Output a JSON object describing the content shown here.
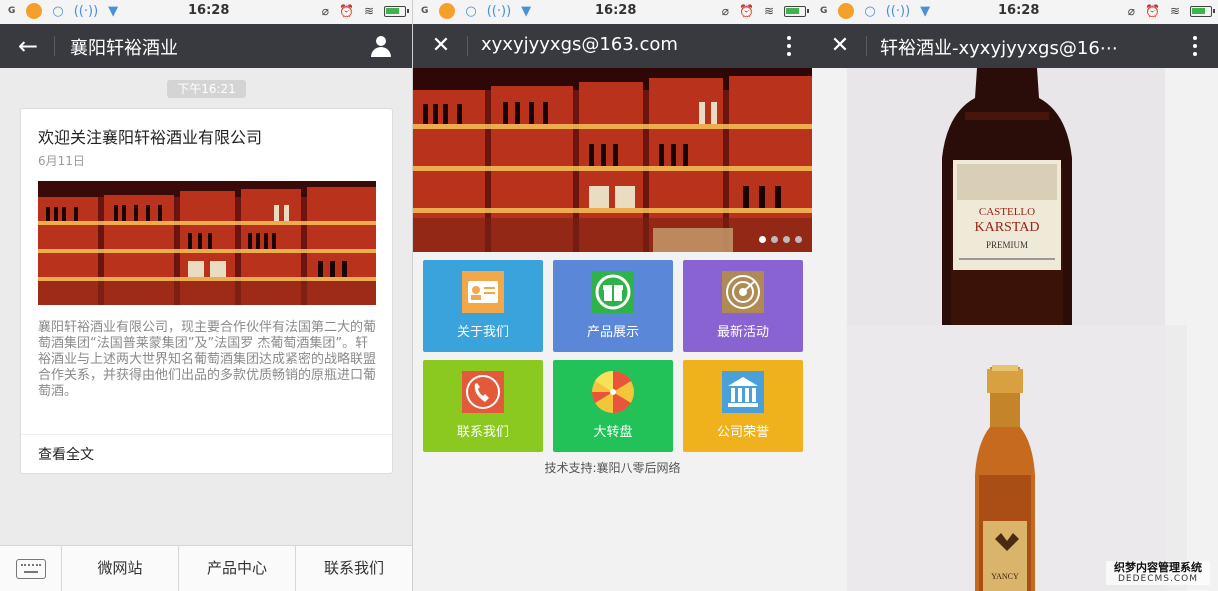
{
  "statusbar": {
    "signal": "G",
    "time": "16:28"
  },
  "chat": {
    "title": "襄阳轩裕酒业",
    "timestamp": "下午16:21",
    "card": {
      "title": "欢迎关注襄阳轩裕酒业有限公司",
      "date": "6月11日",
      "summary": "襄阳轩裕酒业有限公司，现主要合作伙伴有法国第二大的葡萄酒集团“法国普莱蒙集团”及”法国罗 杰葡萄酒集团”。轩裕酒业与上述两大世界知名葡萄酒集团达成紧密的战略联盟合作关系，并获得由他们出品的多款优质畅销的原瓶进口葡萄酒。",
      "read_more": "查看全文"
    },
    "menu": [
      "微网站",
      "产品中心",
      "联系我们"
    ]
  },
  "site": {
    "title": "xyxyjyyxgs@163.com",
    "tiles": [
      {
        "label": "关于我们",
        "icon": "id-card-icon",
        "color": "#3ba3dc"
      },
      {
        "label": "产品展示",
        "icon": "gift-icon",
        "color": "#5b87d8"
      },
      {
        "label": "最新活动",
        "icon": "radar-icon",
        "color": "#8a63d2"
      },
      {
        "label": "联系我们",
        "icon": "phone-icon",
        "color": "#8cc920"
      },
      {
        "label": "大转盘",
        "icon": "lucky-wheel-icon",
        "color": "#22c259"
      },
      {
        "label": "公司荣誉",
        "icon": "institution-icon",
        "color": "#f0b21c"
      }
    ],
    "footer": "技术支持:襄阳八零后网络"
  },
  "product": {
    "title": "轩裕酒业-xyxyjyyxgs@16⋯",
    "label1": {
      "brand": "CASTELLO",
      "name": "KARSTAD",
      "sub": "PREMIUM"
    },
    "label2": {
      "brand": "YANCY"
    }
  },
  "watermark": {
    "cn": "织梦内容管理系统",
    "en": "DEDECMS.COM"
  },
  "colors": {
    "titlebar": "#393a3f",
    "chat_bg": "#ebebeb",
    "wine_red": "#9c2218"
  }
}
